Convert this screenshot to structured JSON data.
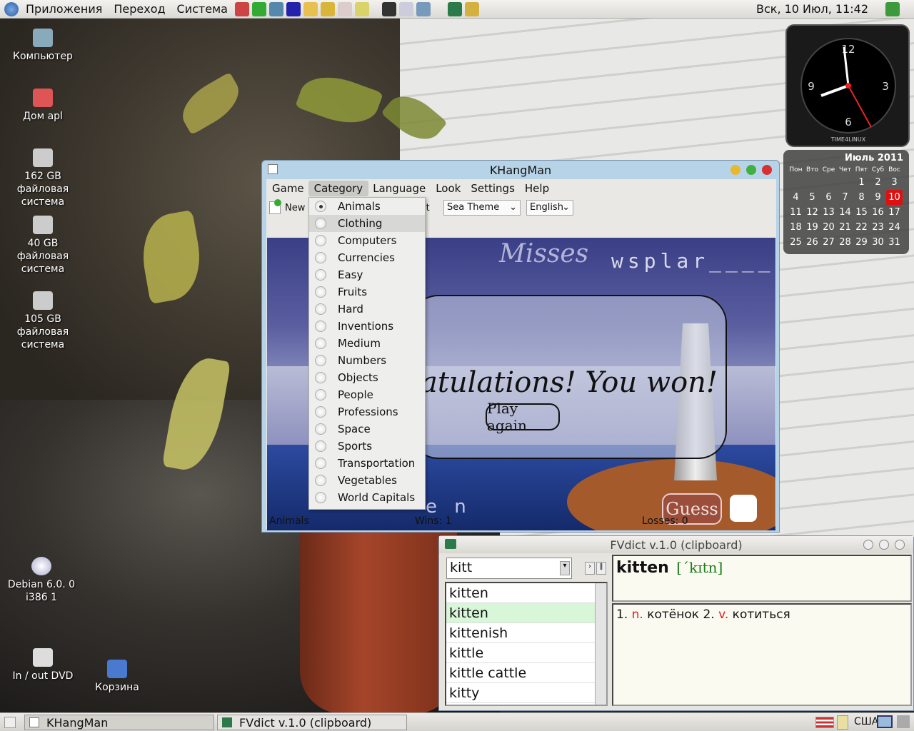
{
  "top_panel": {
    "menus": [
      "Приложения",
      "Переход",
      "Система"
    ],
    "clock": "Вск, 10 Июл, 11:42"
  },
  "desktop": [
    {
      "label": "Компьютер"
    },
    {
      "label": "Дом apl"
    },
    {
      "label": "162 GB файловая система"
    },
    {
      "label": "40 GB файловая система"
    },
    {
      "label": "105 GB файловая система"
    },
    {
      "label": "Debian 6.0. 0 i386 1"
    },
    {
      "label": "In / out DVD"
    },
    {
      "label": "Корзина"
    }
  ],
  "clock_widget": {
    "brand": "TIME4LINUX",
    "n12": "12",
    "n3": "3",
    "n6": "6",
    "n9": "9"
  },
  "calendar": {
    "month": "Июль 2011",
    "weekdays": [
      "Пон",
      "Вто",
      "Сре",
      "Чет",
      "Пят",
      "Суб",
      "Вос"
    ],
    "weeks": [
      [
        "",
        "",
        "",
        "",
        "1",
        "2",
        "3"
      ],
      [
        "4",
        "5",
        "6",
        "7",
        "8",
        "9",
        "10"
      ],
      [
        "11",
        "12",
        "13",
        "14",
        "15",
        "16",
        "17"
      ],
      [
        "18",
        "19",
        "20",
        "21",
        "22",
        "23",
        "24"
      ],
      [
        "25",
        "26",
        "27",
        "28",
        "29",
        "30",
        "31"
      ]
    ],
    "today": "10"
  },
  "khangman": {
    "title": "KHangMan",
    "menus": [
      "Game",
      "Category",
      "Language",
      "Look",
      "Settings",
      "Help"
    ],
    "toolbar": {
      "new": "New",
      "hint": "it",
      "theme": "Sea Theme",
      "language": "English"
    },
    "game": {
      "misses_label": "Misses",
      "misses": "wsplar____",
      "message": "atulations! You won!",
      "play_again": "Play again",
      "word_partial": "e n",
      "guess": "Guess"
    },
    "status": {
      "category": "Animals",
      "wins": "Wins: 1",
      "losses": "Losses: 0"
    },
    "categories": [
      "Animals",
      "Clothing",
      "Computers",
      "Currencies",
      "Easy",
      "Fruits",
      "Hard",
      "Inventions",
      "Medium",
      "Numbers",
      "Objects",
      "People",
      "Professions",
      "Space",
      "Sports",
      "Transportation",
      "Vegetables",
      "World Capitals"
    ],
    "selected_category": "Animals",
    "hovered_category": "Clothing"
  },
  "fvdict": {
    "title": "FVdict v.1.0 (clipboard)",
    "search": "kitt",
    "words": [
      "kitten",
      "kitten",
      "kittenish",
      "kittle",
      "kittle cattle",
      "kitty"
    ],
    "selected_index": 1,
    "headword": "kitten",
    "transcription": "[ˊkɪtn]",
    "def_num1": "1.",
    "pos1": "n.",
    "tr1": "котёнок",
    "def_num2": "2.",
    "pos2": "v.",
    "tr2": "котиться"
  },
  "taskbar": {
    "items": [
      "KHangMan",
      "FVdict v.1.0 (clipboard)"
    ],
    "layout": "США"
  }
}
